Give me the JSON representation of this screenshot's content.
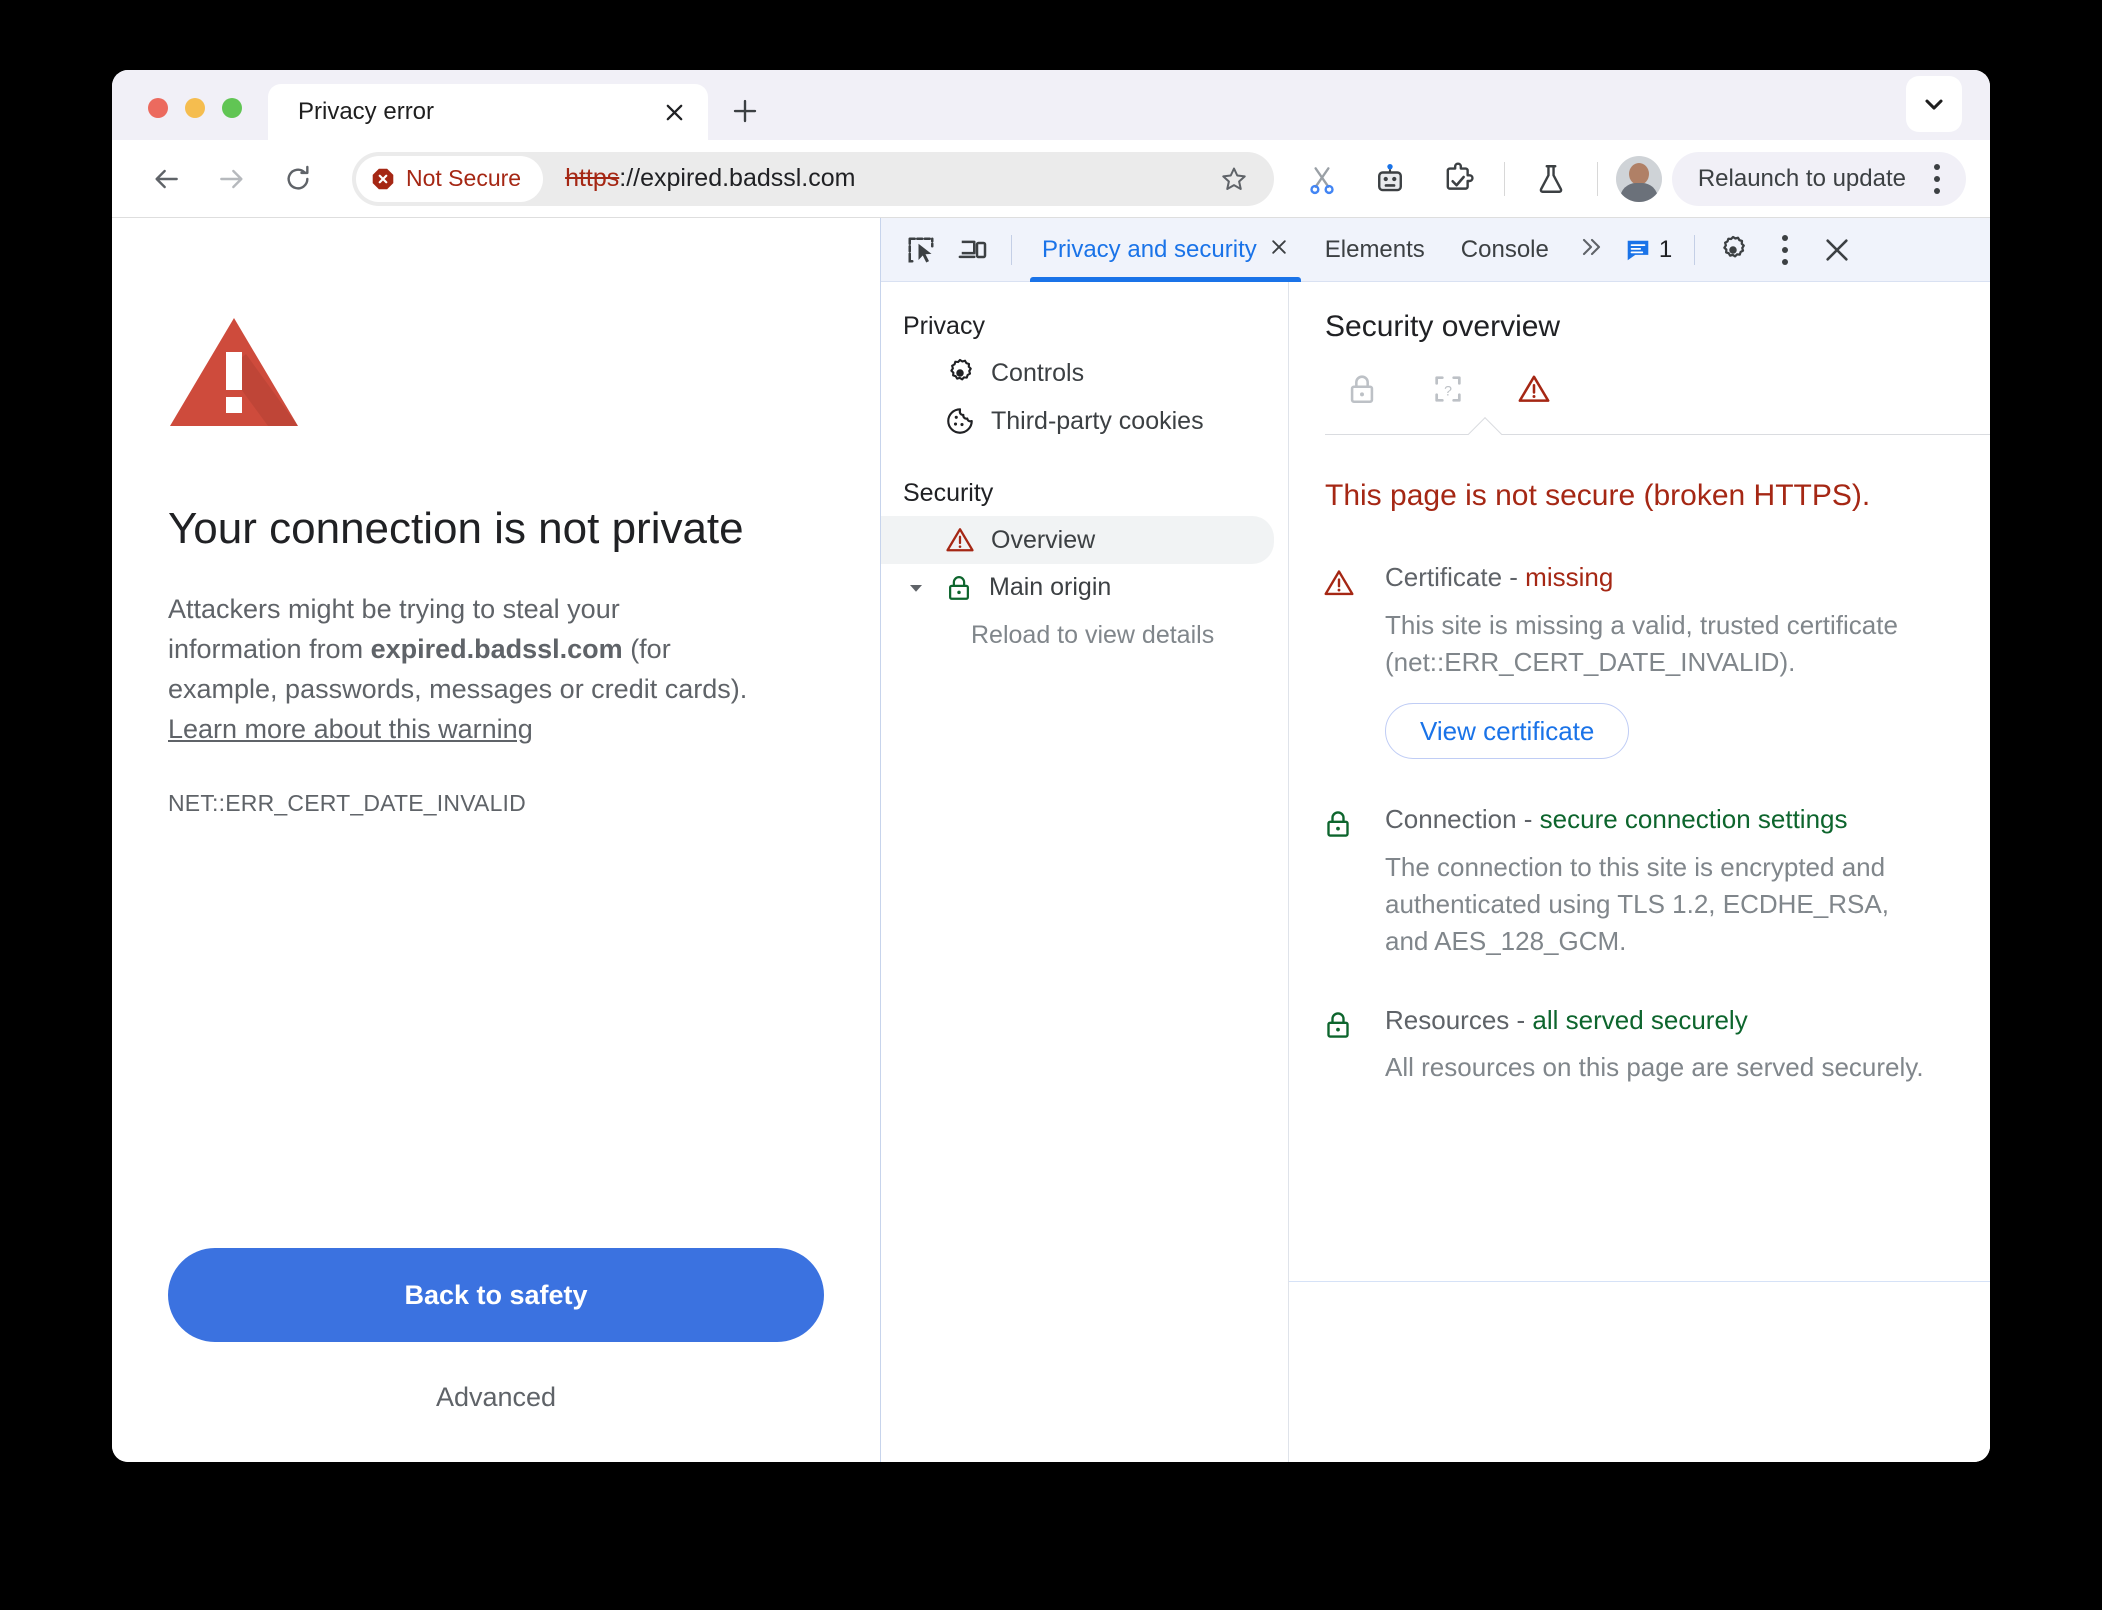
{
  "window": {
    "chevron_icon": "chevron-down-icon"
  },
  "tabstrip": {
    "tab_title": "Privacy error",
    "close_icon": "close-icon",
    "new_tab_icon": "plus-icon"
  },
  "toolbar": {
    "back_icon": "back-arrow-icon",
    "forward_icon": "forward-arrow-icon",
    "reload_icon": "reload-icon",
    "security_chip": {
      "icon": "not-secure-octagon-icon",
      "label": "Not Secure",
      "color": "#a52714"
    },
    "url_scheme": "https",
    "url_rest": "://expired.badssl.com",
    "star_icon": "bookmark-star-icon",
    "icons": [
      {
        "name": "scissors-icon"
      },
      {
        "name": "robot-icon"
      },
      {
        "name": "puzzle-extension-icon"
      },
      {
        "name": "flask-experiments-icon"
      }
    ],
    "avatar_name": "avatar",
    "relaunch_label": "Relaunch to update",
    "menu_icon": "kebab-menu-icon"
  },
  "page": {
    "warning_icon": "warning-triangle-icon",
    "heading": "Your connection is not private",
    "body_part1": "Attackers might be trying to steal your information from ",
    "body_host": "expired.badssl.com",
    "body_part2": " (for example, passwords, messages or credit cards). ",
    "body_link": "Learn more about this warning",
    "error_code": "NET::ERR_CERT_DATE_INVALID",
    "back_button": "Back to safety",
    "advanced_button": "Advanced",
    "accent_color": "#3b72e0"
  },
  "devtools": {
    "inspect_icon": "inspect-element-icon",
    "device_icon": "device-toolbar-icon",
    "tabs": [
      {
        "label": "Privacy and security",
        "active": true,
        "closable": true
      },
      {
        "label": "Elements",
        "active": false,
        "closable": false
      },
      {
        "label": "Console",
        "active": false,
        "closable": false
      }
    ],
    "more_tabs_icon": "chevrons-right-icon",
    "issues_icon": "issues-message-icon",
    "issues_count": "1",
    "settings_icon": "gear-icon",
    "menu_icon": "kebab-menu-icon",
    "close_icon": "close-icon",
    "sidebar": {
      "groups": [
        {
          "header": "Privacy",
          "items": [
            {
              "label": "Controls",
              "icon": "gear-icon",
              "selected": false
            },
            {
              "label": "Third-party cookies",
              "icon": "cookie-icon",
              "selected": false
            }
          ]
        },
        {
          "header": "Security",
          "items": [
            {
              "label": "Overview",
              "icon": "warning-triangle-icon",
              "selected": true
            },
            {
              "label": "Main origin",
              "icon": "lock-green-icon",
              "selected": false,
              "expandable": true
            }
          ],
          "subtext": "Reload to view details"
        }
      ]
    },
    "overview": {
      "title": "Security overview",
      "state_icons": [
        {
          "name": "lock-grey-icon",
          "active": false
        },
        {
          "name": "mixed-content-icon",
          "active": false
        },
        {
          "name": "warning-triangle-red-icon",
          "active": true
        }
      ],
      "summary": "This page is not secure (broken HTTPS).",
      "summary_color": "#a52714",
      "rows": [
        {
          "icon": "warning-triangle-red-icon",
          "label": "Certificate - ",
          "value": "missing",
          "value_state": "bad",
          "description": "This site is missing a valid, trusted certificate (net::ERR_CERT_DATE_INVALID).",
          "button": "View certificate"
        },
        {
          "icon": "lock-green-icon",
          "label": "Connection - ",
          "value": "secure connection settings",
          "value_state": "good",
          "description": "The connection to this site is encrypted and authenticated using TLS 1.2, ECDHE_RSA, and AES_128_GCM.",
          "button": null
        },
        {
          "icon": "lock-green-icon",
          "label": "Resources - ",
          "value": "all served securely",
          "value_state": "good",
          "description": "All resources on this page are served securely.",
          "button": null
        }
      ]
    }
  }
}
